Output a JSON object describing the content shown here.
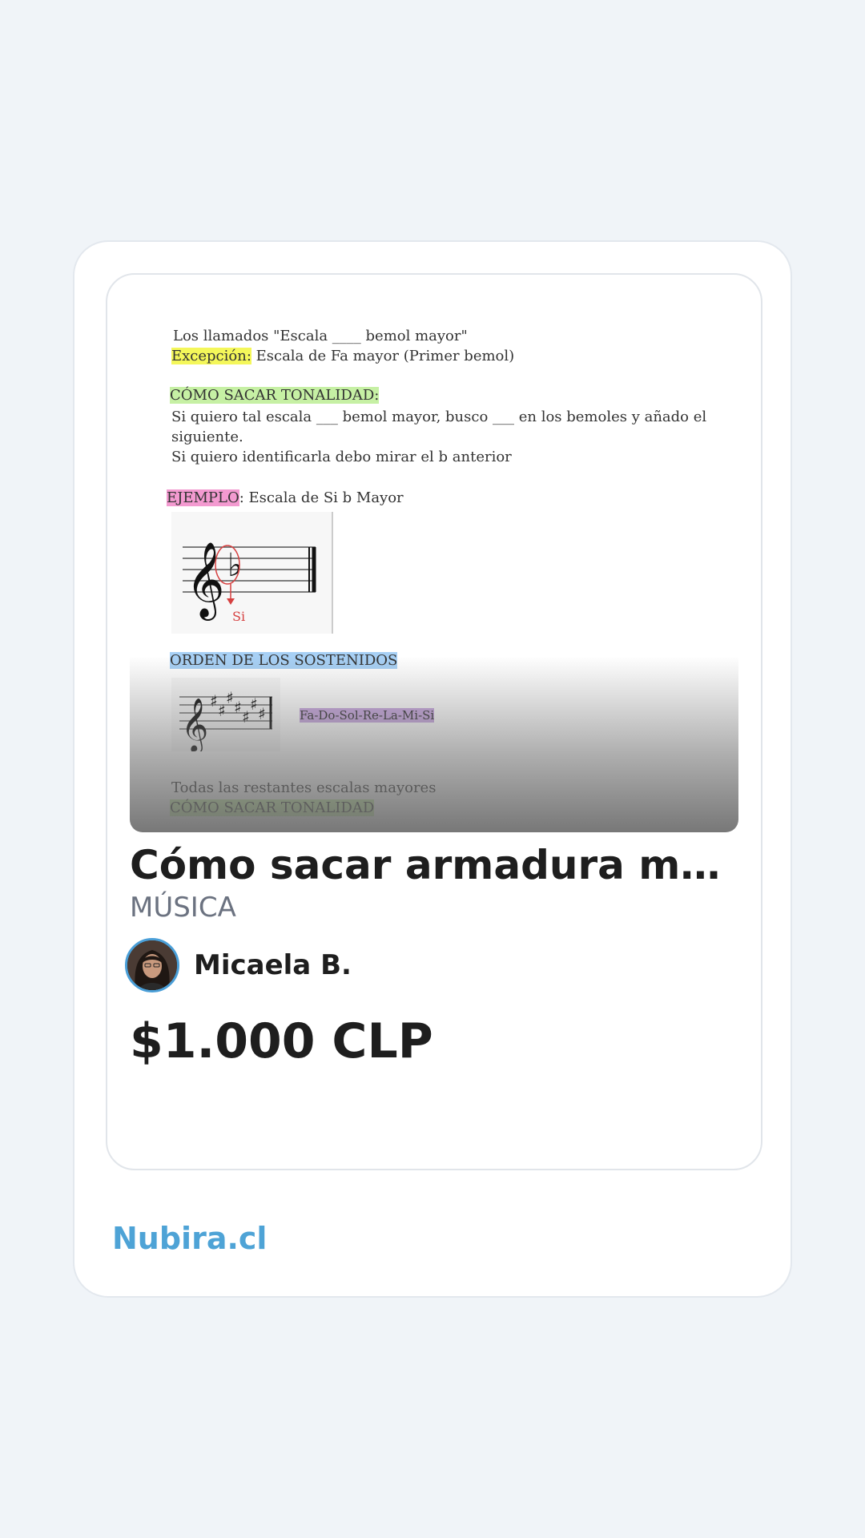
{
  "product": {
    "title": "Cómo sacar armadura music...",
    "category": "MÚSICA",
    "author": "Micaela B.",
    "price": "$1.000 CLP"
  },
  "brand": {
    "name": "Nubira.cl",
    "color": "#4ea3d6"
  },
  "preview_doc": {
    "line1": "Los llamados \"Escala ____ bemol mayor\"",
    "exception_label": "Excepción:",
    "exception_text": " Escala de Fa mayor (Primer bemol)",
    "how_label_1": "CÓMO SACAR TONALIDAD:",
    "line_how_1": "Si quiero tal escala ___ bemol mayor, busco ___ en los bemoles y añado el",
    "line_how_2": "siguiente.",
    "line_how_3": "Si quiero identificarla debo mirar el b anterior",
    "example_label": "EJEMPLO",
    "example_text": ": Escala de Si b Mayor",
    "staff_note": "Si",
    "sharps_label": "ORDEN DE LOS SOSTENIDOS",
    "sharps_sequence": "Fa-Do-Sol-Re-La-Mi-Si",
    "rest_line": "Todas las restantes escalas mayores",
    "how_label_2": "CÓMO SACAR TONALIDAD"
  },
  "icons": {
    "avatar": "user-avatar-photo",
    "treble_clef": "treble-clef-icon",
    "flat": "flat-sign-icon"
  }
}
